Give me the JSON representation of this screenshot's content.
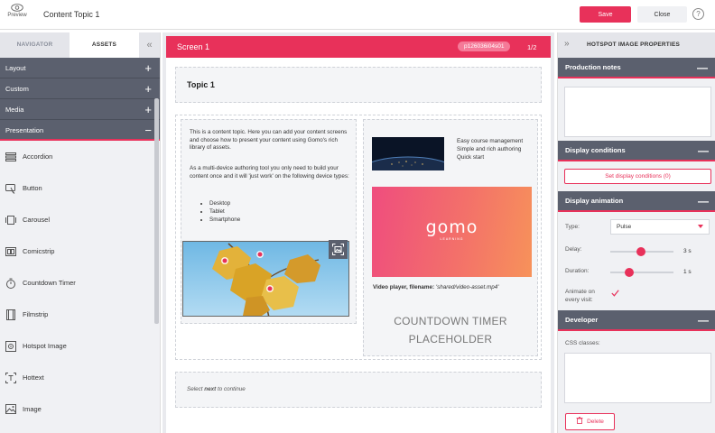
{
  "topbar": {
    "preview_label": "Preview",
    "doc_title": "Content Topic 1",
    "save_label": "Save",
    "close_label": "Close",
    "help_label": "?"
  },
  "left": {
    "tabs": [
      {
        "label": "NAVIGATOR",
        "active": false
      },
      {
        "label": "ASSETS",
        "active": true
      }
    ],
    "collapse_label": "«",
    "categories": [
      {
        "label": "Layout",
        "sign": "+"
      },
      {
        "label": "Custom",
        "sign": "+"
      },
      {
        "label": "Media",
        "sign": "+"
      },
      {
        "label": "Presentation",
        "sign": "−"
      }
    ],
    "assets": [
      {
        "label": "Accordion",
        "icon": "accordion-icon"
      },
      {
        "label": "Button",
        "icon": "button-icon"
      },
      {
        "label": "Carousel",
        "icon": "carousel-icon"
      },
      {
        "label": "Comicstrip",
        "icon": "comicstrip-icon"
      },
      {
        "label": "Countdown Timer",
        "icon": "timer-icon"
      },
      {
        "label": "Filmstrip",
        "icon": "filmstrip-icon"
      },
      {
        "label": "Hotspot Image",
        "icon": "hotspot-image-icon"
      },
      {
        "label": "Hottext",
        "icon": "hottext-icon"
      },
      {
        "label": "Image",
        "icon": "image-icon"
      }
    ]
  },
  "center": {
    "screen_title": "Screen 1",
    "screen_id": "p126036i04s01",
    "screen_page": "1/2",
    "topic_title": "Topic 1",
    "para1": "This is a content topic. Here you can add your content screens and choose how to present your content using Gomo's rich library of assets.",
    "para2": "As a multi-device authoring tool you only need to build your content once and it will 'just work' on the following device types:",
    "devices": [
      "Desktop",
      "Tablet",
      "Smartphone"
    ],
    "features": [
      "Easy course management",
      "Simple and rich authoring",
      "Quick start"
    ],
    "gomo_logo": "gomo",
    "gomo_sub": "LEARNING",
    "video_label_bold": "Video player, filename:",
    "video_filename": "'shared/video-asset.mp4'",
    "countdown_line1": "COUNTDOWN TIMER",
    "countdown_line2": "PLACEHOLDER",
    "footer_pre": "Select ",
    "footer_bold": "next",
    "footer_post": " to continue"
  },
  "right": {
    "expand_label": "»",
    "title": "HOTSPOT IMAGE PROPERTIES",
    "sections": {
      "production_notes": "Production notes",
      "display_conditions": "Display conditions",
      "display_animation": "Display animation",
      "developer": "Developer"
    },
    "collapse_sign": "—",
    "set_conditions_label": "Set display conditions (0)",
    "type_label": "Type:",
    "type_value": "Pulse",
    "delay_label": "Delay:",
    "delay_value": "3 s",
    "delay_fraction": 0.48,
    "duration_label": "Duration:",
    "duration_value": "1 s",
    "duration_fraction": 0.3,
    "animate_label": "Animate on every visit:",
    "animate_checked": true,
    "css_label": "CSS classes:",
    "delete_label": "Delete"
  },
  "colors": {
    "accent": "#e8315a",
    "panel_dark": "#5b606e"
  }
}
